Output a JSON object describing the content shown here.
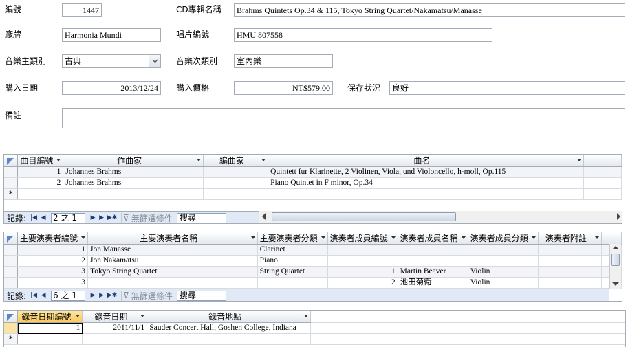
{
  "form": {
    "id_label": "編號",
    "id_value": "1447",
    "album_label": "CD專輯名稱",
    "album_value": "Brahms Quintets Op.34 & 115, Tokyo String Quartet/Nakamatsu/Manasse",
    "brand_label": "廠牌",
    "brand_value": "Harmonia Mundi",
    "catalog_label": "唱片編號",
    "catalog_value": "HMU 807558",
    "genre_label": "音樂主類別",
    "genre_value": "古典",
    "subgenre_label": "音樂次類別",
    "subgenre_value": "室內樂",
    "date_label": "購入日期",
    "date_value": "2013/12/24",
    "price_label": "購入價格",
    "price_value": "NT$579.00",
    "condition_label": "保存狀況",
    "condition_value": "良好",
    "notes_label": "備註",
    "notes_value": ""
  },
  "tracks": {
    "headers": [
      "曲目編號",
      "作曲家",
      "編曲家",
      "曲名"
    ],
    "rows": [
      [
        "1",
        "Johannes Brahms",
        "",
        "Quintett fur Klarinette, 2 Violinen, Viola, und Violoncello, h-moll, Op.115"
      ],
      [
        "2",
        "Johannes Brahms",
        "",
        "Piano Quintet in F minor, Op.34"
      ]
    ],
    "new_row_marker": "*",
    "nav": {
      "record_label": "記錄:",
      "position": "2 之 1",
      "filter": "無篩選條件",
      "search": "搜尋"
    }
  },
  "performers": {
    "headers": [
      "主要演奏者編號",
      "主要演奏者名稱",
      "主要演奏者分類",
      "演奏者成員編號",
      "演奏者成員名稱",
      "演奏者成員分類",
      "演奏者附註"
    ],
    "rows": [
      [
        "1",
        "Jon Manasse",
        "Clarinet",
        "",
        "",
        "",
        ""
      ],
      [
        "2",
        "Jon Nakamatsu",
        "Piano",
        "",
        "",
        "",
        ""
      ],
      [
        "3",
        "Tokyo String Quartet",
        "String Quartet",
        "1",
        "Martin Beaver",
        "Violin",
        ""
      ],
      [
        "3",
        "",
        "",
        "2",
        "池田菊衛",
        "Violin",
        ""
      ]
    ],
    "nav": {
      "record_label": "記錄:",
      "position": "6 之 1",
      "filter": "無篩選條件",
      "search": "搜尋"
    }
  },
  "recordings": {
    "headers": [
      "錄音日期編號",
      "錄音日期",
      "錄音地點"
    ],
    "rows": [
      [
        "1",
        "2011/11/1",
        "Sauder Concert Hall, Goshen College, Indiana"
      ]
    ],
    "new_row_marker": "*"
  }
}
